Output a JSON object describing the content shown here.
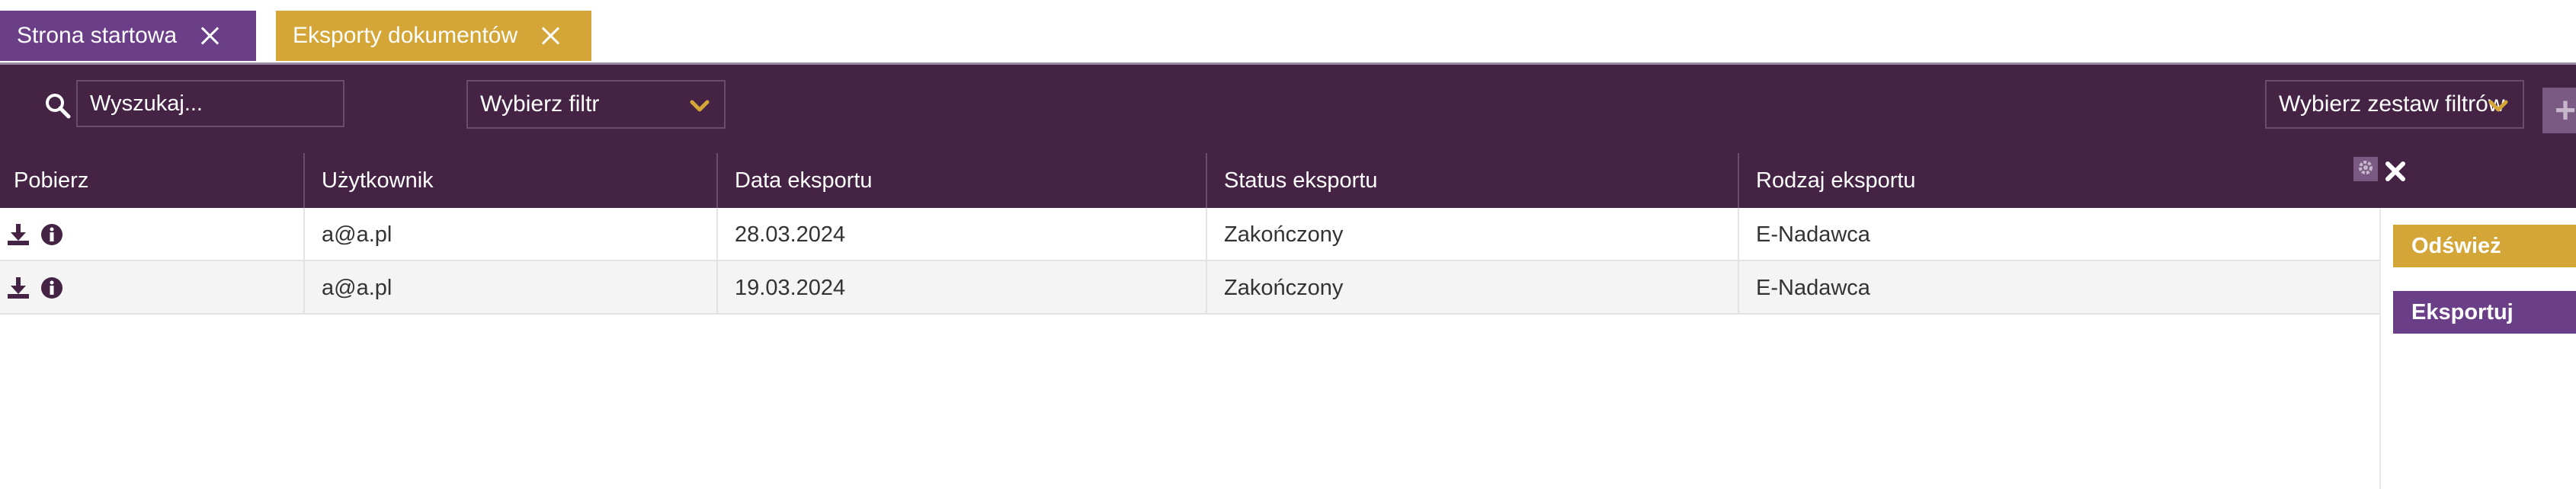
{
  "colors": {
    "primary": "#442345",
    "tab_active": "#d4a637",
    "tab_home": "#6b3e88",
    "export_button": "#6b3e88",
    "refresh_button": "#d4a637",
    "chevron": "#d4a637"
  },
  "tabs": [
    {
      "label": "Strona startowa",
      "icon": "close-icon"
    },
    {
      "label": "Eksporty dokumentów",
      "icon": "close-icon"
    }
  ],
  "toolbar": {
    "search_placeholder": "Wyszukaj...",
    "search_icon": "search-icon",
    "filter_select": "Wybierz filtr",
    "filterset_select": "Wybierz zestaw filtrów",
    "add_label": "+"
  },
  "table": {
    "columns": [
      "Pobierz",
      "Użytkownik",
      "Data eksportu",
      "Status eksportu",
      "Rodzaj eksportu"
    ],
    "rows": [
      {
        "user": "a@a.pl",
        "date": "28.03.2024",
        "status": "Zakończony",
        "type": "E-Nadawca"
      },
      {
        "user": "a@a.pl",
        "date": "19.03.2024",
        "status": "Zakończony",
        "type": "E-Nadawca"
      }
    ]
  },
  "side_panel": {
    "refresh_label": "Odśwież",
    "export_label": "Eksportuj"
  }
}
